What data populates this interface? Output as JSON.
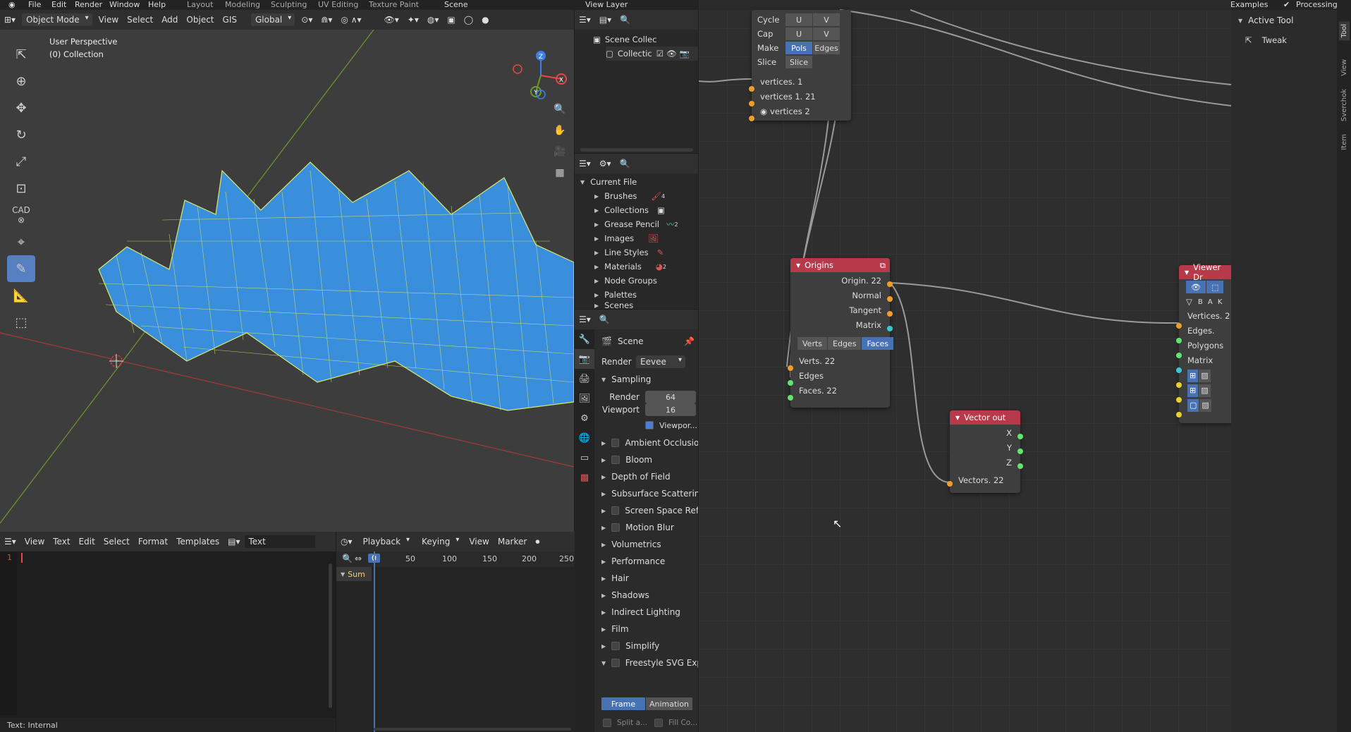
{
  "topbar": {
    "menus": [
      "File",
      "Edit",
      "Render",
      "Window",
      "Help"
    ],
    "workspaces": [
      "Layout",
      "Modeling",
      "Sculpting",
      "UV Editing",
      "Texture Paint"
    ],
    "scene": "Scene",
    "view_layer": "View Layer",
    "examples": "Examples",
    "processing": "Processing"
  },
  "viewport": {
    "mode": "Object Mode",
    "menus": [
      "View",
      "Select",
      "Add",
      "Object",
      "GIS"
    ],
    "orientation": "Global",
    "perspective": "User Perspective",
    "collection": "(0) Collection",
    "cad_label": "CAD",
    "gizmo_axes": [
      "X",
      "Y",
      "Z"
    ]
  },
  "outliner": {
    "scene_collection": "Scene Collec",
    "collection": "Collectic"
  },
  "filebrowser": {
    "root": "Current File",
    "items": [
      "Brushes",
      "Collections",
      "Grease Pencil",
      "Images",
      "Line Styles",
      "Materials",
      "Node Groups",
      "Palettes",
      "Scenes"
    ],
    "badges": {
      "brushes": "4",
      "grease_pencil": "2",
      "materials": "2"
    }
  },
  "props": {
    "scene_label": "Scene",
    "render_label": "Render ...",
    "engine": "Eevee",
    "sampling": "Sampling",
    "render_samples_label": "Render",
    "render_samples": "64",
    "viewport_samples_label": "Viewport",
    "viewport_samples": "16",
    "viewport_denoise": "Viewpor...",
    "sections": [
      {
        "label": "Ambient Occlusion",
        "checkbox": true
      },
      {
        "label": "Bloom",
        "checkbox": true
      },
      {
        "label": "Depth of Field",
        "checkbox": false
      },
      {
        "label": "Subsurface Scattering",
        "checkbox": false
      },
      {
        "label": "Screen Space Refle",
        "checkbox": true
      },
      {
        "label": "Motion Blur",
        "checkbox": true
      },
      {
        "label": "Volumetrics",
        "checkbox": false
      },
      {
        "label": "Performance",
        "checkbox": false
      },
      {
        "label": "Hair",
        "checkbox": false
      },
      {
        "label": "Shadows",
        "checkbox": false
      },
      {
        "label": "Indirect Lighting",
        "checkbox": false
      },
      {
        "label": "Film",
        "checkbox": false
      },
      {
        "label": "Simplify",
        "checkbox": true
      },
      {
        "label": "Freestyle SVG Exp",
        "checkbox": true
      }
    ],
    "frame_btn": "Frame",
    "animation_btn": "Animation",
    "split_label": "Split a...",
    "fill_label": "Fill Co..."
  },
  "texteditor": {
    "menus": [
      "View",
      "Text",
      "Edit",
      "Select",
      "Format",
      "Templates"
    ],
    "text_name": "Text",
    "line_number": "1",
    "status": "Text: Internal"
  },
  "timeline": {
    "menus": [
      "Playback",
      "Keying",
      "View",
      "Marker"
    ],
    "current_frame": "0",
    "ticks": [
      "50",
      "100",
      "150",
      "200",
      "250"
    ],
    "summary": "Sum"
  },
  "nodes": {
    "top_node": {
      "rows": [
        {
          "label": "Cycle",
          "a": "U",
          "b": "V"
        },
        {
          "label": "Cap",
          "a": "U",
          "b": "V"
        },
        {
          "label": "Make",
          "a": "Pols",
          "b": "Edges"
        },
        {
          "label": "Slice",
          "a": "Slice",
          "b": ""
        }
      ],
      "outputs": [
        "vertices. 1",
        "vertices 1. 21",
        "vertices 2"
      ]
    },
    "origins": {
      "title": "Origins",
      "outputs": [
        "Origin. 22",
        "Normal",
        "Tangent",
        "Matrix"
      ],
      "modes": [
        "Verts",
        "Edges",
        "Faces"
      ],
      "inputs": [
        "Verts. 22",
        "Edges",
        "Faces. 22"
      ]
    },
    "vector_out": {
      "title": "Vector out",
      "outputs": [
        "X",
        "Y",
        "Z"
      ],
      "input": "Vectors. 22"
    },
    "viewer": {
      "title": "Viewer Dr",
      "bake": "B A K",
      "inputs": [
        "Vertices. 2",
        "Edges.",
        "Polygons",
        "Matrix"
      ]
    }
  },
  "sidebar": {
    "active_tool": "Active Tool",
    "tool": "Tweak",
    "tabs": [
      "Tool",
      "View",
      "Sverchok",
      "Item"
    ]
  },
  "colors": {
    "accent": "#4772b3",
    "node_header": "#b8394a",
    "mesh": "#3a8fdc"
  }
}
